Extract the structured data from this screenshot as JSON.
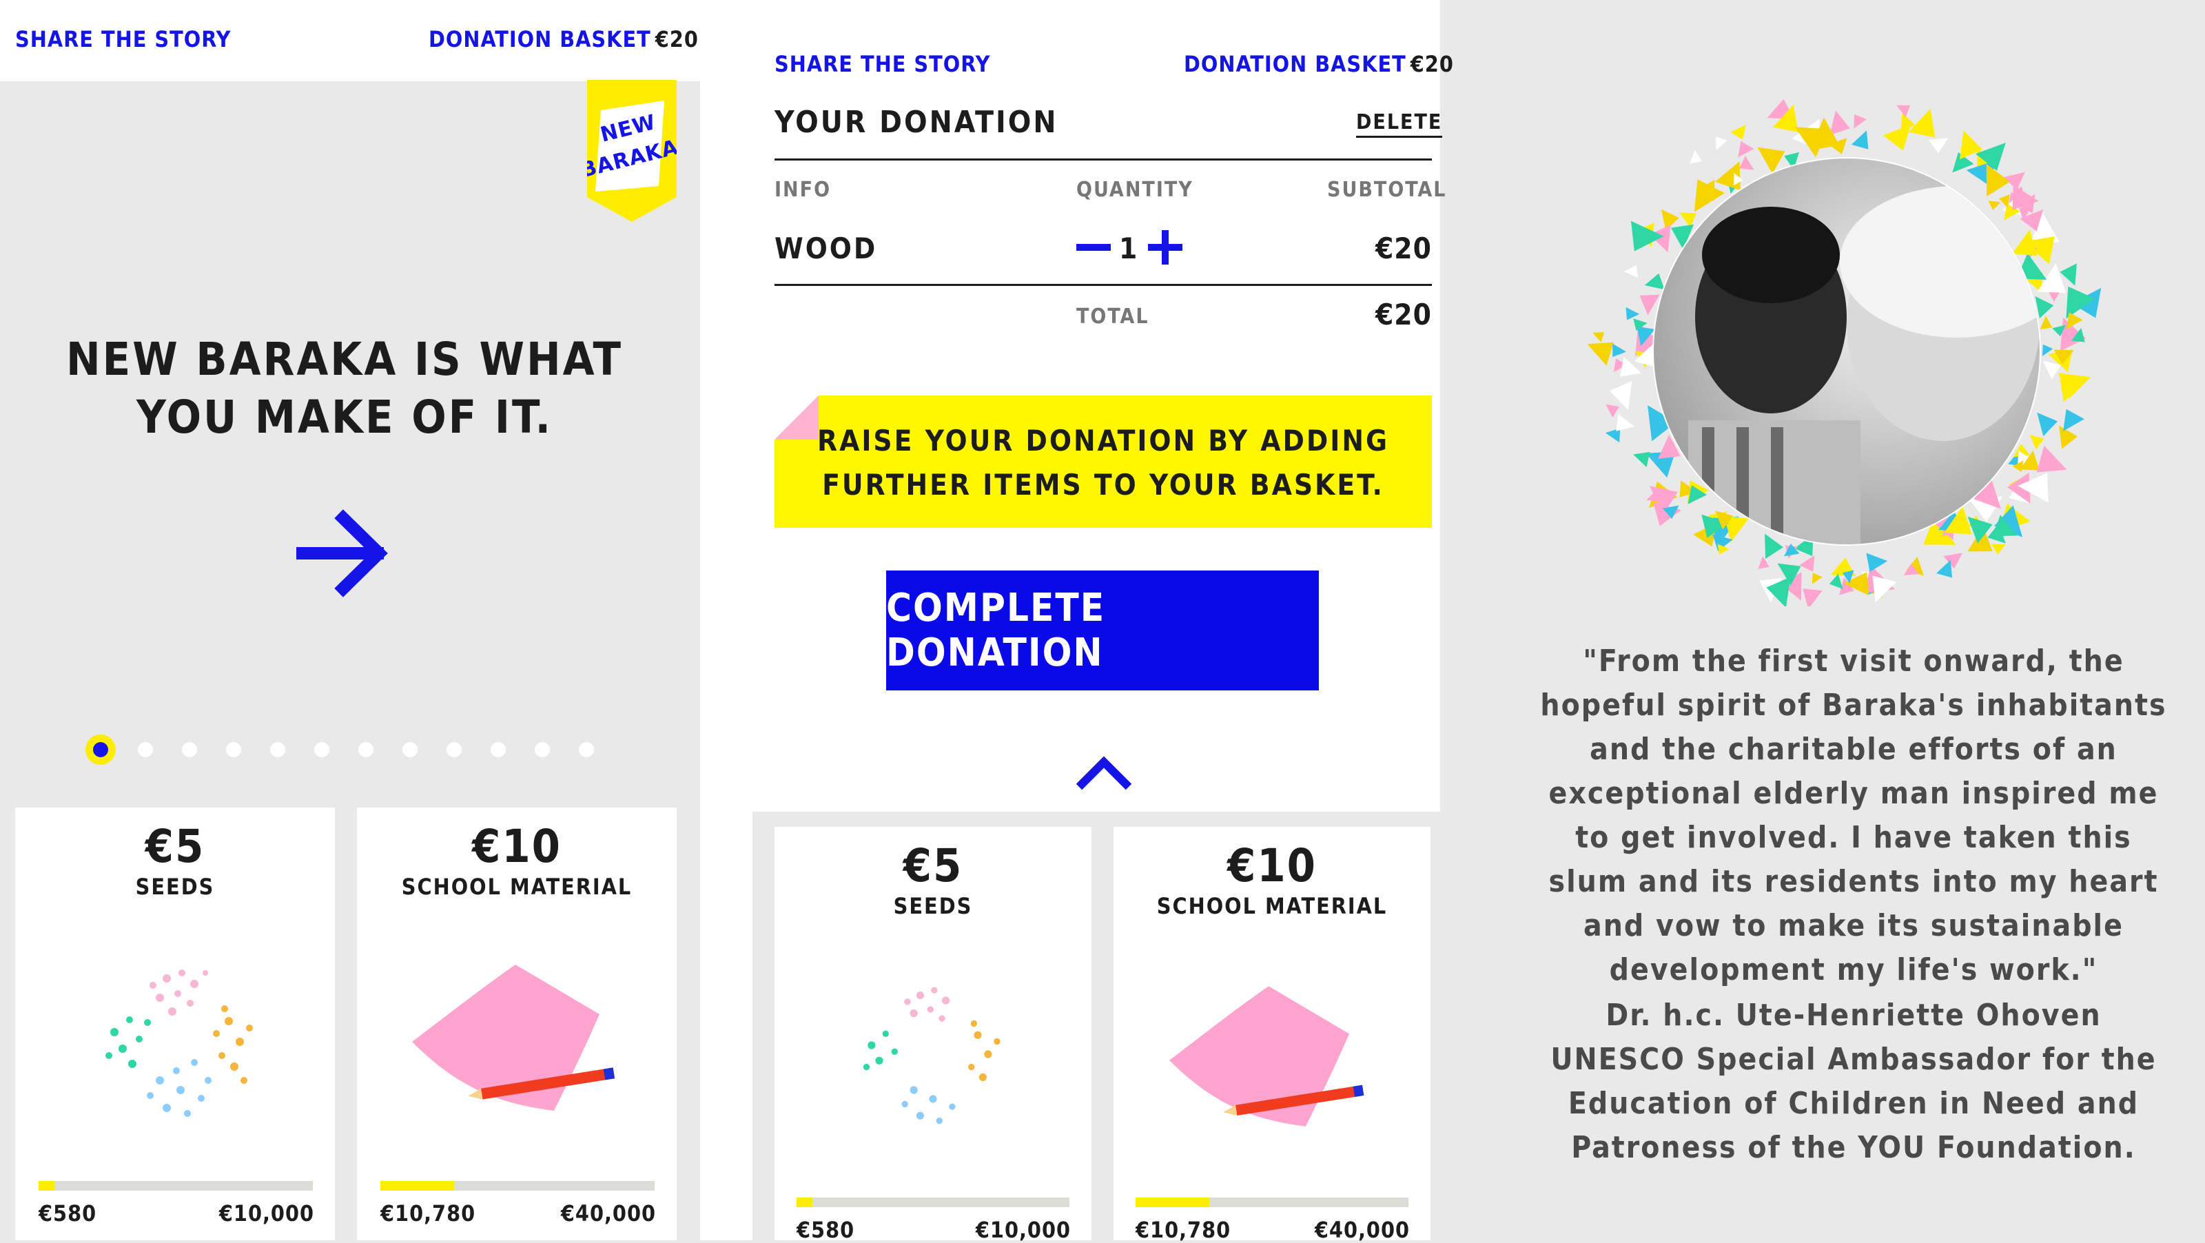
{
  "left": {
    "share": "SHARE THE STORY",
    "basket_label": "DONATION BASKET",
    "basket_amount": "€20",
    "badge_line1": "NEW",
    "badge_line2": "BARAKA",
    "headline": "NEW BARAKA IS WHAT YOU MAKE OF IT.",
    "slides_total": 12,
    "slide_active": 1,
    "cards": [
      {
        "price": "€5",
        "name": "SEEDS",
        "raised": "€580",
        "goal": "€10,000",
        "progress": 0.058
      },
      {
        "price": "€10",
        "name": "SCHOOL MATERIAL",
        "raised": "€10,780",
        "goal": "€40,000",
        "progress": 0.27
      }
    ]
  },
  "middle": {
    "share": "SHARE THE STORY",
    "basket_label": "DONATION BASKET",
    "basket_amount": "€20",
    "title": "YOUR DONATION",
    "delete": "DELETE",
    "col_info": "INFO",
    "col_qty": "QUANTITY",
    "col_subtotal": "SUBTOTAL",
    "item_name": "WOOD",
    "item_qty": "1",
    "item_subtotal": "€20",
    "total_label": "TOTAL",
    "total_amount": "€20",
    "note": "RAISE YOUR DONATION BY ADDING FURTHER ITEMS TO YOUR BASKET.",
    "complete": "COMPLETE DONATION",
    "cards": [
      {
        "price": "€5",
        "name": "SEEDS",
        "raised": "€580",
        "goal": "€10,000",
        "progress": 0.058
      },
      {
        "price": "€10",
        "name": "SCHOOL MATERIAL",
        "raised": "€10,780",
        "goal": "€40,000",
        "progress": 0.27
      }
    ]
  },
  "right": {
    "quote": "\"From the first visit onward, the hopeful spirit of Baraka's inhabitants and the charitable efforts of an exceptional elderly man inspired me to get involved. I have taken this slum and its residents into my heart and vow to make its sustainable development my life's work.\"",
    "author_name": "Dr. h.c. Ute-Henriette Ohoven",
    "author_title": "UNESCO Special Ambassador for the Education of Children in Need and Patroness of the YOU Foundation."
  },
  "colors": {
    "blue": "#1414e6",
    "yellow": "#ffed00",
    "pink": "#ffb3d1"
  }
}
